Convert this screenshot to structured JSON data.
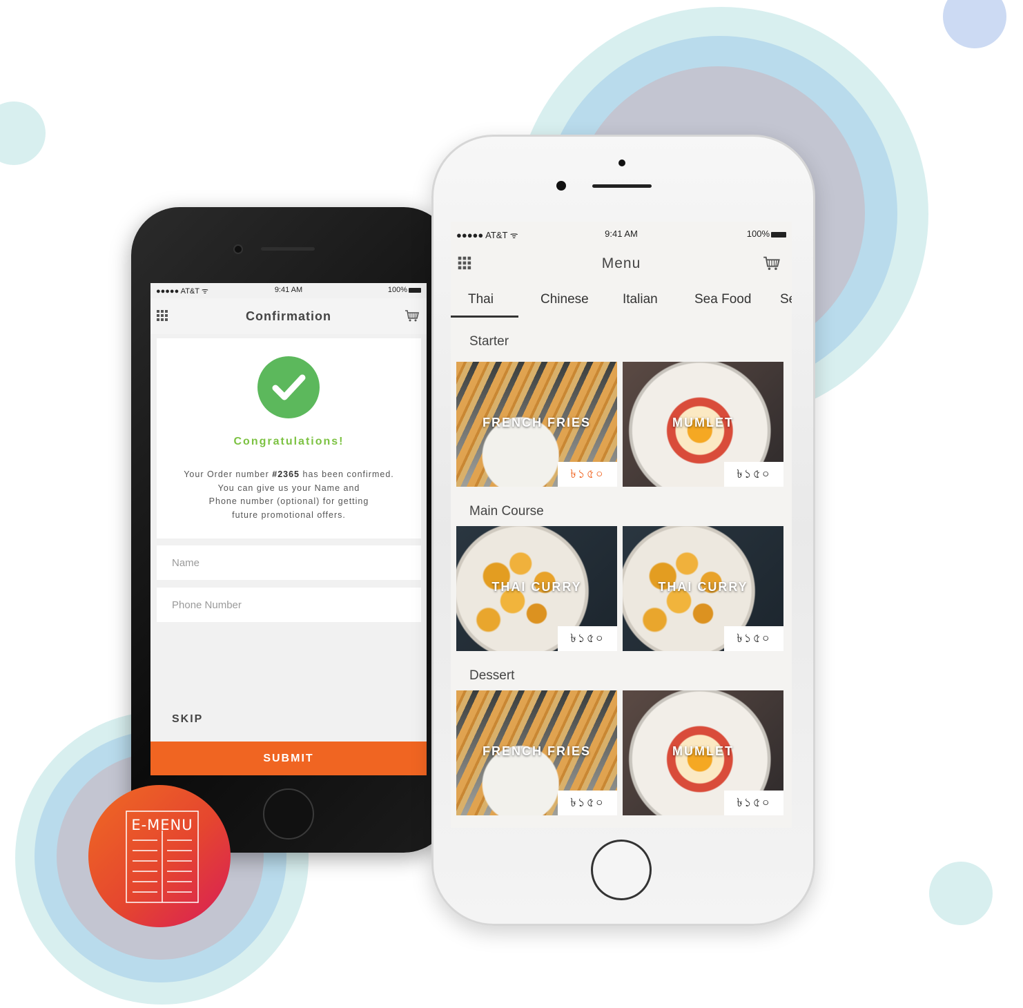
{
  "colors": {
    "accent_orange": "#f06522",
    "success_green": "#5cb85c",
    "congrats_green": "#7cc242",
    "bg_circle_light": "#d8efef",
    "bg_circle_blue": "#b9dbec",
    "bg_circle_gray": "#c3c5d1",
    "bg_dot_blue": "#ccdaf3"
  },
  "status_bar": {
    "carrier": "●●●●● AT&T ᯤ",
    "time": "9:41 AM",
    "battery": "100%"
  },
  "confirmation_screen": {
    "title": "Confirmation",
    "icons": {
      "menu": "grid-menu-icon",
      "cart": "cart-icon",
      "success": "check-circle-icon"
    },
    "heading": "Congratulations!",
    "message_prefix": "Your Order number ",
    "order_number": "#2365",
    "message_suffix": " has been confirmed.",
    "message_line2": "You can give us your Name and",
    "message_line3": "Phone number (optional) for getting",
    "message_line4": "future promotional offers.",
    "name_placeholder": "Name",
    "phone_placeholder": "Phone Number",
    "skip_label": "SKIP",
    "submit_label": "SUBMIT"
  },
  "menu_screen": {
    "title": "Menu",
    "icons": {
      "menu": "grid-menu-icon",
      "cart": "cart-icon"
    },
    "tabs": [
      {
        "label": "Thai",
        "active": true
      },
      {
        "label": "Chinese",
        "active": false
      },
      {
        "label": "Italian",
        "active": false
      },
      {
        "label": "Sea Food",
        "active": false
      },
      {
        "label": "Se",
        "active": false
      }
    ],
    "sections": [
      {
        "title": "Starter",
        "items": [
          {
            "name": "FRENCH FRIES",
            "price": "৳১৫০",
            "price_color": "#f06522"
          },
          {
            "name": "MUMLET",
            "price": "৳১৫০",
            "price_color": "#333333"
          }
        ]
      },
      {
        "title": "Main Course",
        "items": [
          {
            "name": "THAI CURRY",
            "price": "৳১৫০",
            "price_color": "#333333"
          },
          {
            "name": "THAI CURRY",
            "price": "৳১৫০",
            "price_color": "#333333"
          }
        ]
      },
      {
        "title": "Dessert",
        "items": [
          {
            "name": "FRENCH FRIES",
            "price": "৳১৫০",
            "price_color": "#333333"
          },
          {
            "name": "MUMLET",
            "price": "৳১৫০",
            "price_color": "#333333"
          }
        ]
      }
    ]
  },
  "logo": {
    "text": "E-MENU",
    "icon": "menu-book-icon"
  }
}
